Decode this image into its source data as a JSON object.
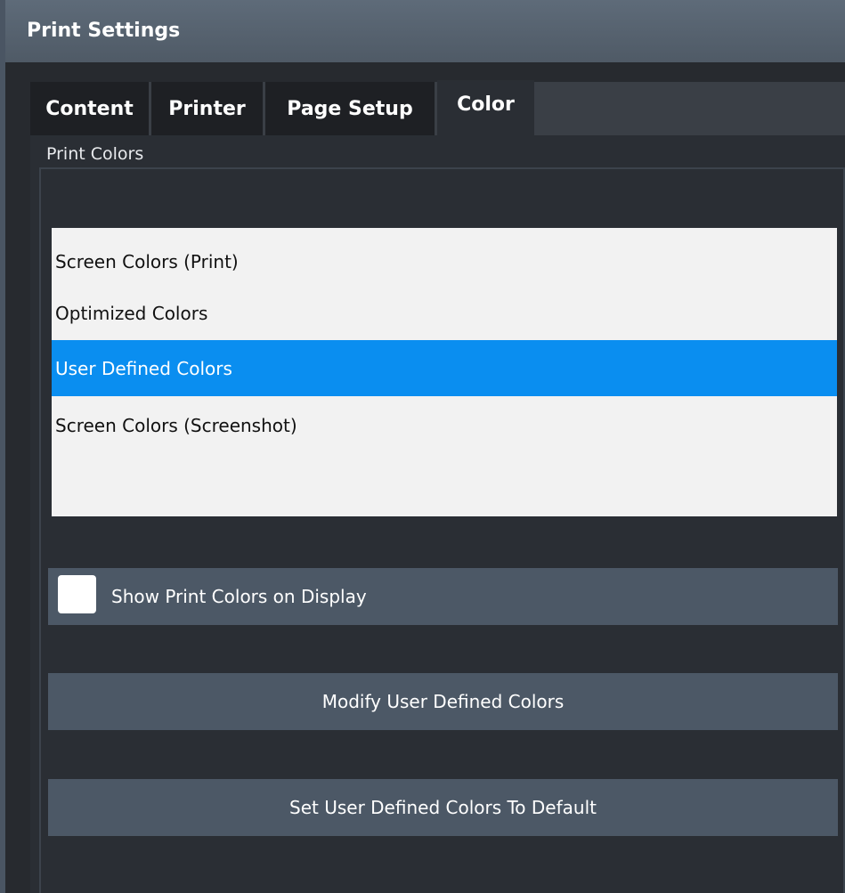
{
  "dialog": {
    "title": "Print Settings"
  },
  "tabs": [
    {
      "label": "Content"
    },
    {
      "label": "Printer"
    },
    {
      "label": "Page Setup"
    },
    {
      "label": "Color"
    }
  ],
  "active_tab": "Color",
  "print_colors": {
    "group_label": "Print Colors",
    "options": [
      {
        "label": "Screen Colors (Print)"
      },
      {
        "label": "Optimized Colors"
      },
      {
        "label": "User Defined Colors"
      },
      {
        "label": "Screen Colors (Screenshot)"
      }
    ],
    "selected": "User Defined Colors"
  },
  "show_print_colors": {
    "label": "Show Print Colors on Display",
    "checked": false
  },
  "buttons": {
    "modify": "Modify User Defined Colors",
    "set_default": "Set User Defined Colors To Default"
  },
  "colors": {
    "selection": "#0a8ef0",
    "title_bar": "#56626f",
    "button": "#4c5866"
  }
}
